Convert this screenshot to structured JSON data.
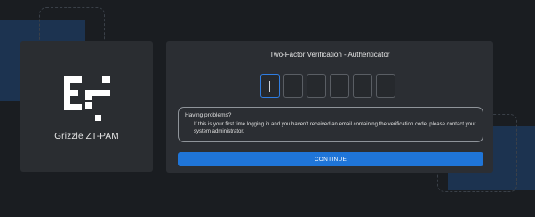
{
  "brand": {
    "name": "Grizzle ZT-PAM",
    "logo_icon": "grizzle-logo-icon"
  },
  "verification": {
    "title": "Two-Factor Verification - Authenticator",
    "code_digit_count": 6,
    "active_digit_index": 1
  },
  "help": {
    "heading": "Having problems?",
    "items": [
      "If this is your first time logging in and you haven't received an email containing the verification code, please contact your system administrator."
    ]
  },
  "actions": {
    "continue_label": "CONTINUE"
  },
  "colors": {
    "background": "#1a1d21",
    "card": "#2b2e33",
    "accent": "#1f75d8",
    "decor_blue": "#1c3350"
  }
}
